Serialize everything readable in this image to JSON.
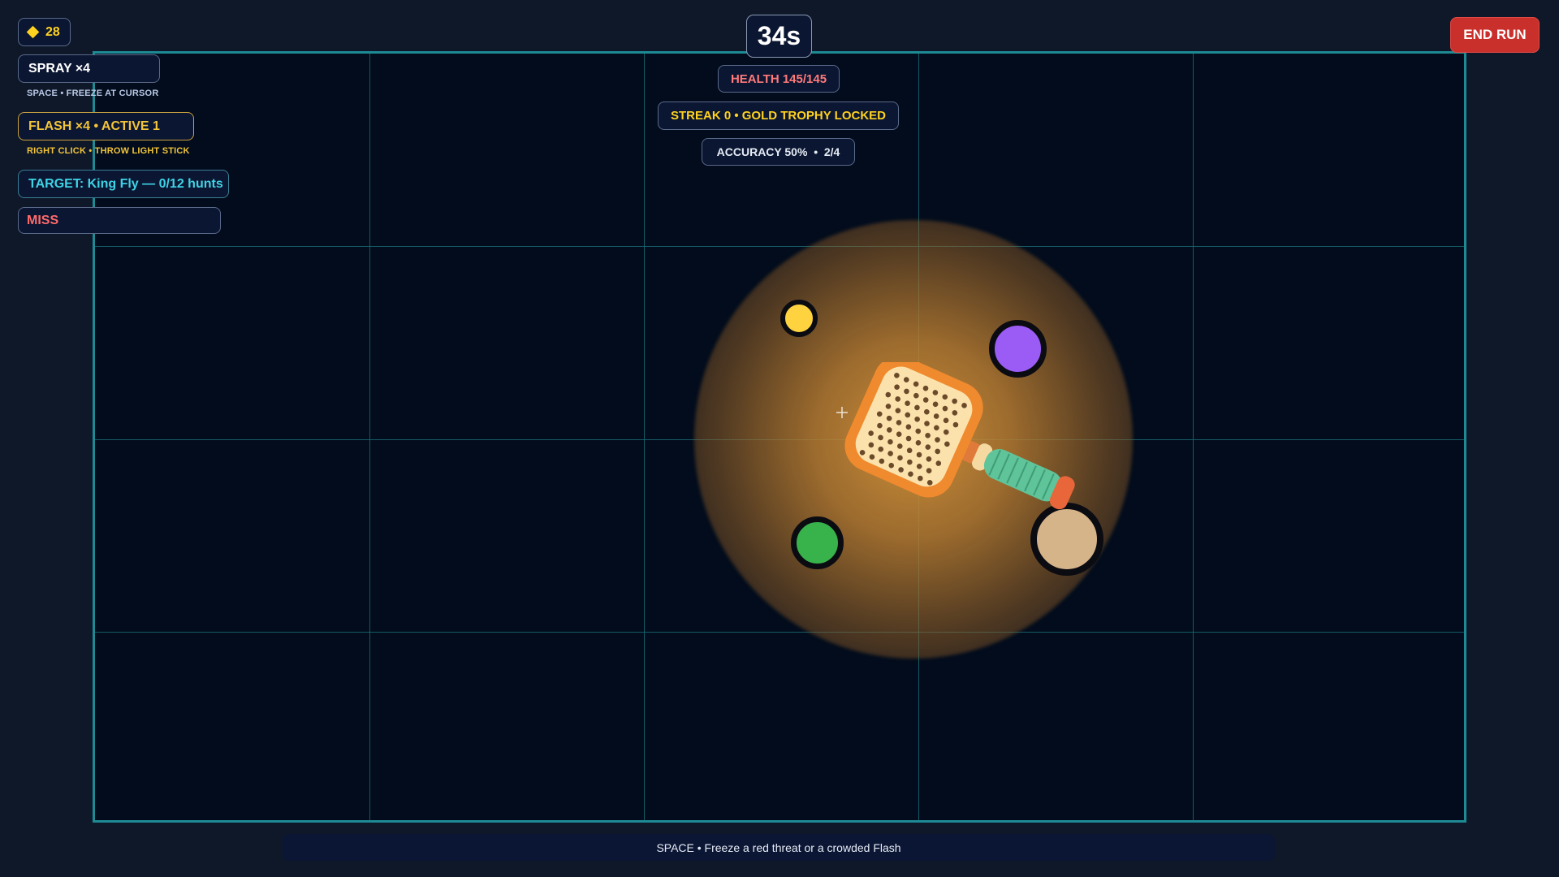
{
  "hud": {
    "coins": {
      "icon": "diamond-icon",
      "value": "28"
    },
    "spray": {
      "label": "SPRAY ×4",
      "hint": "SPACE • FREEZE AT CURSOR"
    },
    "flash": {
      "label": "FLASH ×4 • ACTIVE 1",
      "hint": "RIGHT CLICK • THROW LIGHT STICK"
    },
    "target": {
      "label": "TARGET: King Fly — 0/12 hunts"
    },
    "result": {
      "label": "MISS"
    },
    "timer": "34s",
    "health": "HEALTH 145/145",
    "streak": "STREAK 0 • GOLD TROPHY LOCKED",
    "accuracy": "ACCURACY 50%  •  2/4",
    "end_run": "END RUN",
    "bottom_hint": "SPACE • Freeze a red threat or a crowded Flash"
  },
  "colors": {
    "accent_cyan": "#1d8a94",
    "coin": "#ffd21f",
    "spray": "#ffffff",
    "flash": "#f2c43a",
    "target": "#3fd3e6",
    "miss": "#ff6b6b",
    "health": "#ff7a7a",
    "streak": "#ffd21f",
    "end_run": "#c9302c"
  },
  "bugs": [
    {
      "name": "yellow-fly",
      "color": "#ffd23f"
    },
    {
      "name": "purple-fly",
      "color": "#9b5cf6"
    },
    {
      "name": "green-fly",
      "color": "#38b24a"
    },
    {
      "name": "tan-fly",
      "color": "#d6b48a"
    }
  ],
  "player": {
    "tool": "fly-swatter-icon"
  }
}
